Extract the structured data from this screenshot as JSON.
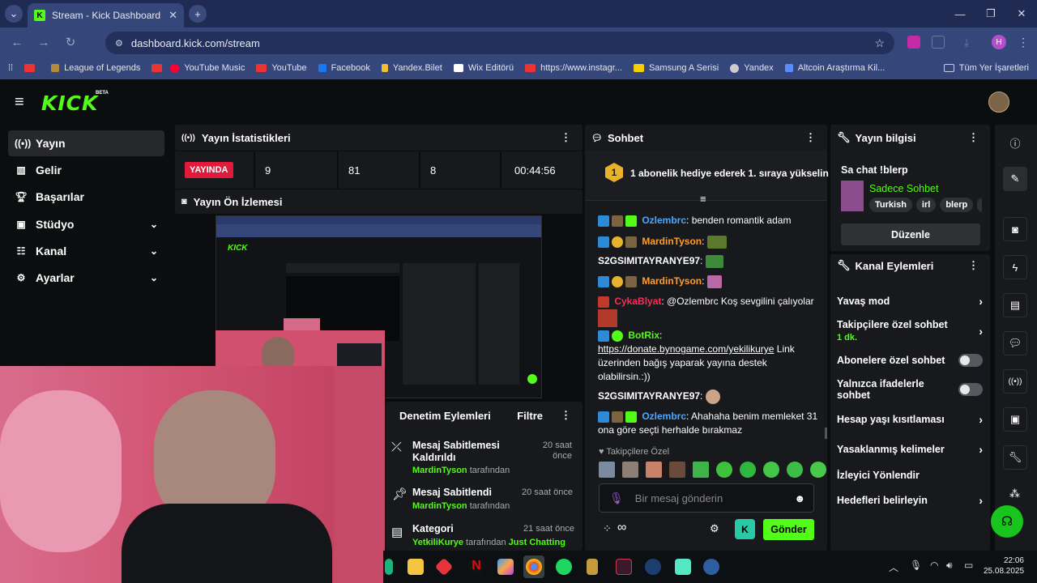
{
  "browser": {
    "tab_title": "Stream - Kick Dashboard",
    "url": "dashboard.kick.com/stream",
    "profile_initial": "H",
    "bookmarks": [
      "League of Legends",
      "YouTube Music",
      "YouTube",
      "Facebook",
      "Yandex.Bilet",
      "Wix Editörü",
      "https://www.instagr...",
      "Samsung A Serisi",
      "Yandex",
      "Altcoin Araştırma Kil...",
      "Tüm Yer İşaretleri"
    ]
  },
  "kick": {
    "logo": "KICK",
    "beta": "BETA"
  },
  "sidebar": {
    "items": [
      {
        "label": "Yayın",
        "icon": "broadcast-icon"
      },
      {
        "label": "Gelir",
        "icon": "chart-icon"
      },
      {
        "label": "Başarılar",
        "icon": "trophy-icon"
      },
      {
        "label": "Stüdyo",
        "icon": "camera-icon"
      },
      {
        "label": "Kanal",
        "icon": "users-icon"
      },
      {
        "label": "Ayarlar",
        "icon": "gear-icon"
      }
    ]
  },
  "stats": {
    "title": "Yayın İstatistikleri",
    "live_badge": "YAYINDA",
    "values": [
      "9",
      "81",
      "8",
      "00:44:56"
    ]
  },
  "preview": {
    "title": "Yayın Ön İzlemesi"
  },
  "moderation": {
    "title": "Denetim Eylemleri",
    "filter": "Filtre",
    "by": "tarafından",
    "items": [
      {
        "action": "Mesaj Sabitlemesi Kaldırıldı",
        "user": "MardinTyson",
        "time": "20 saat önce"
      },
      {
        "action": "Mesaj Sabitlendi",
        "user": "MardinTyson",
        "time": "20 saat önce"
      },
      {
        "action": "Kategori",
        "user": "YetkiliKurye",
        "time": "21 saat önce",
        "extra": "Just Chatting"
      }
    ]
  },
  "chat": {
    "title": "Sohbet",
    "gift_num": "1",
    "gift_text": "1 abonelik hediye ederek 1. sıraya yükselin",
    "messages": [
      {
        "user": "Ozlembrc",
        "color": "#4ea7ff",
        "text": ": benden romantik adam"
      },
      {
        "user": "MardinTyson",
        "color": "#ff9d2e",
        "text": ":"
      },
      {
        "user": "S2GSIMITAYRANYE97",
        "color": "#ffffff",
        "text": ":"
      },
      {
        "user": "MardinTyson",
        "color": "#ff9d2e",
        "text": ":"
      },
      {
        "user": "CykaBlyat",
        "color": "#ff2a55",
        "text": ": @Ozlembrc Koş sevgilini çalıyolar"
      },
      {
        "user": "BotRix",
        "color": "#53fc18",
        "text": ":"
      },
      {
        "user": "S2GSIMITAYRANYE97",
        "color": "#ffffff",
        "text": ":"
      },
      {
        "user": "Ozlembrc",
        "color": "#4ea7ff",
        "text": ": Ahahaha benim memleket 31 ona göre seçti herhalde bırakmaz"
      }
    ],
    "botrix_link": "https://donate.bynogame.com/yekilikurye",
    "botrix_text": " Link üzerinden bağış yaparak yayına destek olabilirsin.:))",
    "followers_only": "Takipçilere Özel",
    "input_placeholder": "Bir mesaj gönderin",
    "infinity": "∞",
    "send": "Gönder"
  },
  "stream_info": {
    "title": "Yayın bilgisi",
    "stream_title": "Sa chat !blerp",
    "category": "Sadece Sohbet",
    "tags": [
      "Turkish",
      "irl",
      "blerp"
    ],
    "edit": "Düzenle"
  },
  "channel_actions": {
    "title": "Kanal Eylemleri",
    "slow_mode": "Yavaş mod",
    "followers_chat": "Takipçilere özel sohbet",
    "followers_chat_sub": "1 dk.",
    "subs_chat": "Abonelere özel sohbet",
    "emote_chat": "Yalnızca ifadelerle sohbet",
    "age_restrict": "Hesap yaşı kısıtlaması",
    "banned_words": "Yasaklanmış kelimeler",
    "viewer_redirect": "İzleyici Yönlendir",
    "goals": "Hedefleri belirleyin"
  },
  "taskbar": {
    "time": "22:06",
    "date": "25.08.2025"
  }
}
